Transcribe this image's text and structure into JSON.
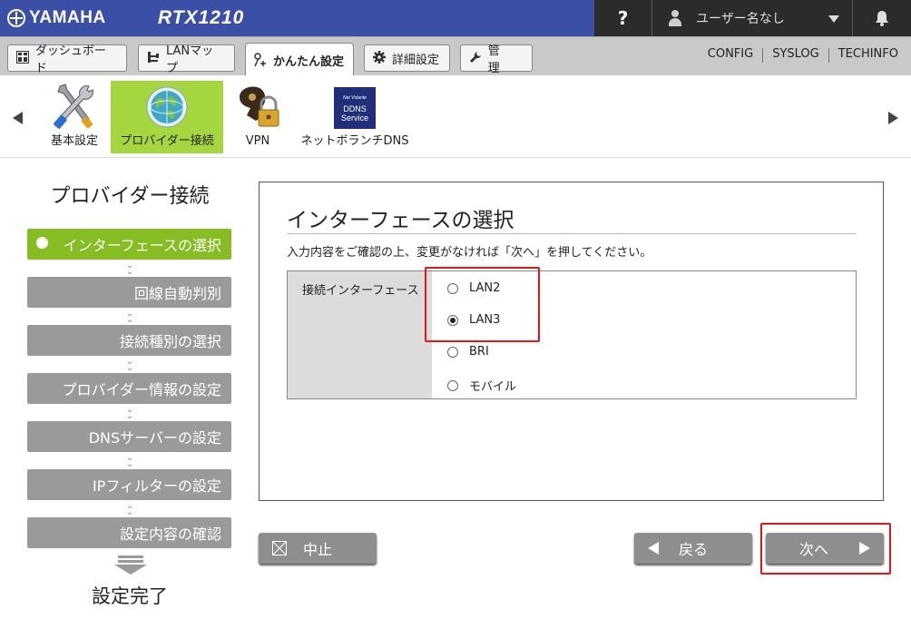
{
  "header": {
    "brand": "YAMAHA",
    "model": "RTX1210",
    "help_label": "?",
    "user_label": "ユーザー名なし"
  },
  "tabs": [
    {
      "label": "ダッシュボード",
      "icon": "dashboard-icon"
    },
    {
      "label": "LANマップ",
      "icon": "lanmap-icon"
    },
    {
      "label": "かんたん設定",
      "icon": "wizard-icon",
      "active": true
    },
    {
      "label": "詳細設定",
      "icon": "gear-icon"
    },
    {
      "label": "管　理",
      "icon": "wrench-icon"
    }
  ],
  "top_links": [
    "CONFIG",
    "SYSLOG",
    "TECHINFO"
  ],
  "icon_strip": [
    {
      "label": "基本設定",
      "icon": "tools-icon"
    },
    {
      "label": "プロバイダー接続",
      "icon": "globe-icon",
      "active": true
    },
    {
      "label": "VPN",
      "icon": "vpn-lock-icon"
    },
    {
      "label": "ネットボランチDNS",
      "icon": "ddns-service-icon",
      "badge_top": "Net Volante",
      "badge_line1": "DDNS",
      "badge_line2": "Service"
    }
  ],
  "wizard": {
    "title": "プロバイダー接続",
    "steps": [
      "インターフェースの選択",
      "回線自動判別",
      "接続種別の選択",
      "プロバイダー情報の設定",
      "DNSサーバーの設定",
      "IPフィルターの設定",
      "設定内容の確認"
    ],
    "active_step": 0,
    "done_label": "設定完了"
  },
  "panel": {
    "title": "インターフェースの選択",
    "description": "入力内容をご確認の上、変更がなければ「次へ」を押してください。",
    "field_label": "接続インターフェース",
    "options": [
      "LAN2",
      "LAN3",
      "BRI",
      "モバイル"
    ],
    "selected": "LAN3"
  },
  "buttons": {
    "cancel": "中止",
    "back": "戻る",
    "next": "次へ"
  },
  "colors": {
    "header_bg": "#3b4fa6",
    "accent_green": "#86bd23",
    "step_gray": "#9a9a9a",
    "highlight_red": "#e8141b"
  }
}
